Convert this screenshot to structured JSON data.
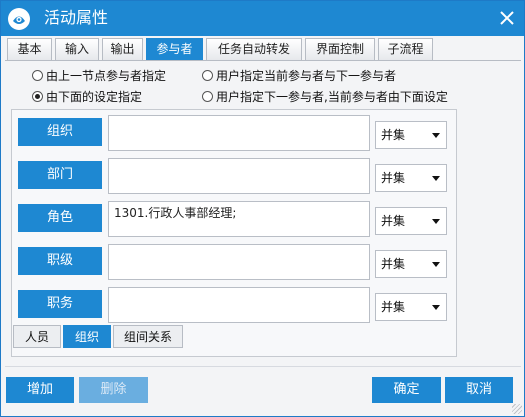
{
  "window": {
    "title": "活动属性",
    "icon": "app-logo-icon",
    "close_icon": "close-icon"
  },
  "tabs": [
    {
      "label": "基本"
    },
    {
      "label": "输入"
    },
    {
      "label": "输出"
    },
    {
      "label": "参与者",
      "active": true
    },
    {
      "label": "任务自动转发"
    },
    {
      "label": "界面控制"
    },
    {
      "label": "子流程"
    }
  ],
  "options": {
    "parent_node": "由上一节点参与者指定",
    "user_current_next": "用户指定当前参与者与下一参与者",
    "by_settings": "由下面的设定指定",
    "user_next_current_below": "用户指定下一参与者,当前参与者由下面设定",
    "selected": "by_settings"
  },
  "rows": [
    {
      "label": "组织",
      "value": "",
      "mode": "并集"
    },
    {
      "label": "部门",
      "value": "",
      "mode": "并集"
    },
    {
      "label": "角色",
      "value": "1301.行政人事部经理;",
      "mode": "并集"
    },
    {
      "label": "职级",
      "value": "",
      "mode": "并集"
    },
    {
      "label": "职务",
      "value": "",
      "mode": "并集"
    }
  ],
  "subtabs": [
    {
      "label": "人员"
    },
    {
      "label": "组织",
      "active": true
    },
    {
      "label": "组间关系"
    }
  ],
  "buttons": {
    "add": "增加",
    "delete": "删除",
    "ok": "确定",
    "cancel": "取消"
  },
  "colors": {
    "accent": "#1e88d2",
    "accent_disabled": "#6aaee0"
  }
}
